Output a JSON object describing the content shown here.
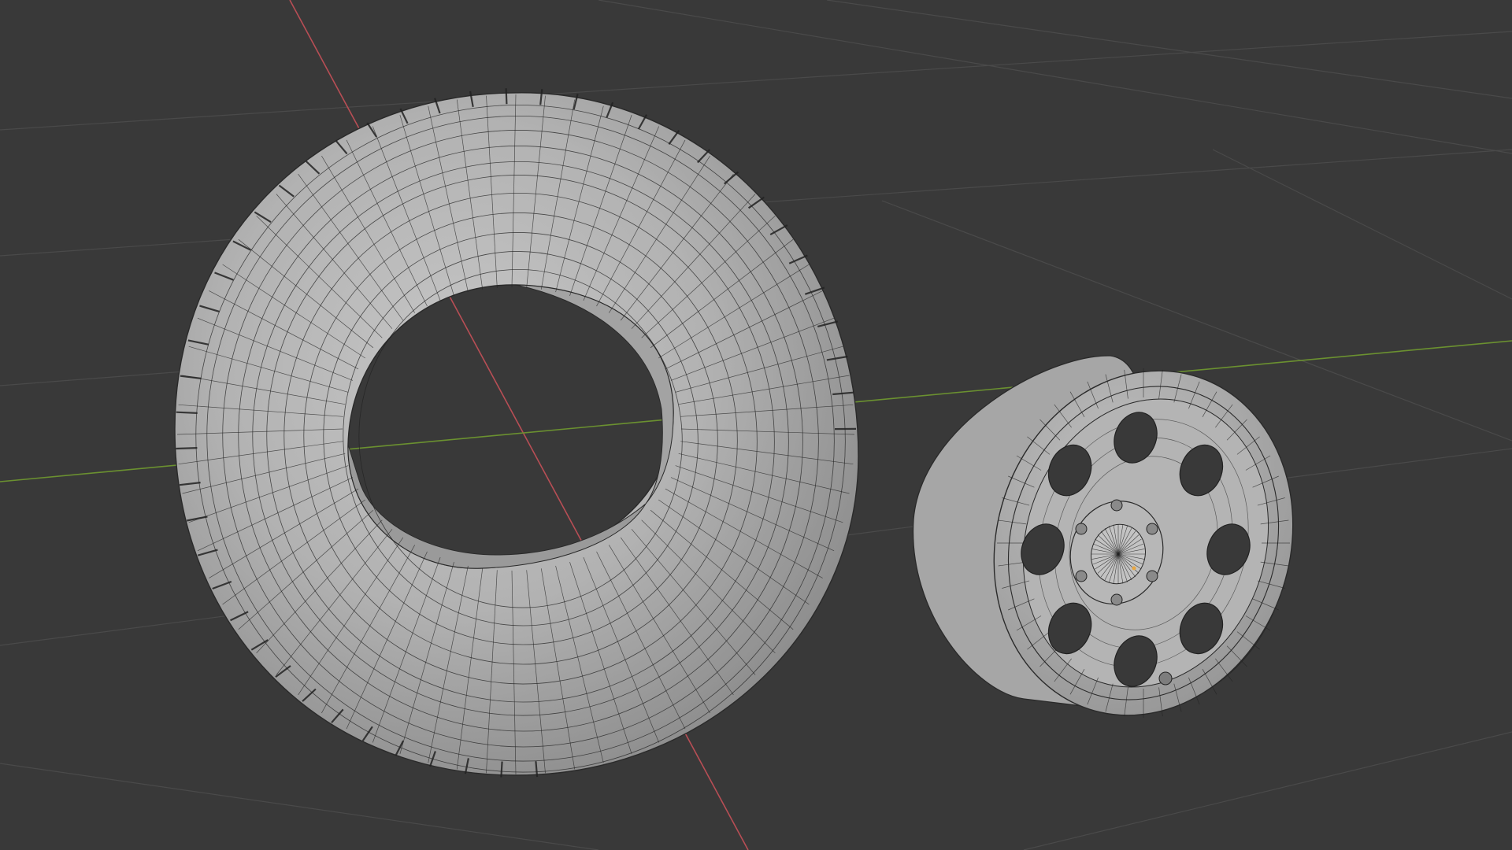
{
  "viewport": {
    "background_color": "#393939",
    "grid_color": "#4a4a4a",
    "x_axis_color": "#b84e55",
    "y_axis_color": "#6b9130",
    "mesh_fill_color": "#aeaeae",
    "mesh_shadow_color": "#8e8e8e",
    "mesh_highlight_color": "#c4c4c4",
    "wire_color": "#222222",
    "origin_dot_color": "#e8a640"
  },
  "objects": [
    {
      "name": "tire",
      "type": "torus-mesh",
      "selected": false
    },
    {
      "name": "rim",
      "type": "wheel-mesh",
      "holes": 8,
      "lug_nuts": 6,
      "selected": false
    }
  ]
}
